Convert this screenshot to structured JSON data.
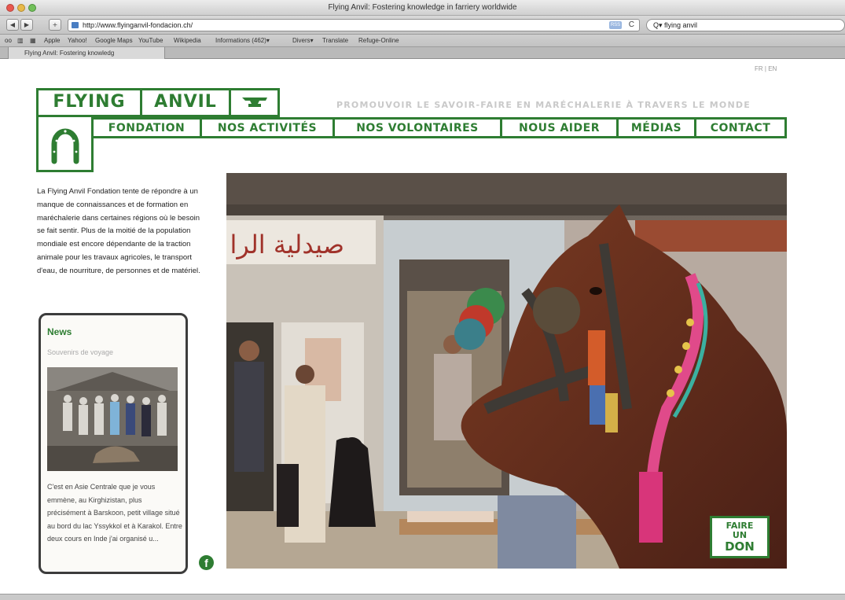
{
  "window": {
    "title": "Flying Anvil: Fostering knowledge in farriery worldwide",
    "tab_label": "Flying Anvil: Fostering knowledg",
    "url": "http://www.flyinganvil-fondacion.ch/",
    "search_value": "flying anvil",
    "rss_label": "RSS",
    "reload_label": "C",
    "back_label": "◀",
    "fwd_label": "▶",
    "add_label": "+"
  },
  "bookmarks": [
    "Apple",
    "Yahoo!",
    "Google Maps",
    "YouTube",
    "Wikipedia",
    "Informations (462)▾",
    "Divers▾",
    "Translate",
    "Refuge-Online"
  ],
  "page": {
    "lang": "FR | EN",
    "logo_left": "FLYING",
    "logo_right": "ANVIL",
    "tagline": "PROMOUVOIR LE SAVOIR-FAIRE EN MARÉCHALERIE À TRAVERS LE MONDE",
    "nav": [
      "FONDATION",
      "NOS ACTIVITÉS",
      "NOS VOLONTAIRES",
      "NOUS AIDER",
      "MÉDIAS",
      "CONTACT"
    ],
    "intro": "La Flying Anvil Fondation tente de répondre à un manque de connaissances et de formation en maréchalerie dans certaines régions où le besoin se fait sentir. Plus de la moitié de la population mondiale est encore dépendante de la traction animale pour les travaux agricoles, le transport d'eau, de nourriture, de personnes et de matériel.",
    "news_title": "News",
    "news_subtitle": "Souvenirs de voyage",
    "news_text": "C'est en Asie Centrale que je vous emmène, au Kirghizistan, plus précisément à Barskoon, petit village situé au bord du lac Yssykkol et à Karakol. Entre deux cours en Inde j'ai organisé u...",
    "fb_label": "f",
    "don_line1": "FAIRE",
    "don_line2": "UN",
    "don_line3": "DON",
    "sign_text": "صيدلية الرا"
  },
  "colors": {
    "brand_green": "#2e7d32",
    "tagline_gray": "#c9c9c9"
  }
}
